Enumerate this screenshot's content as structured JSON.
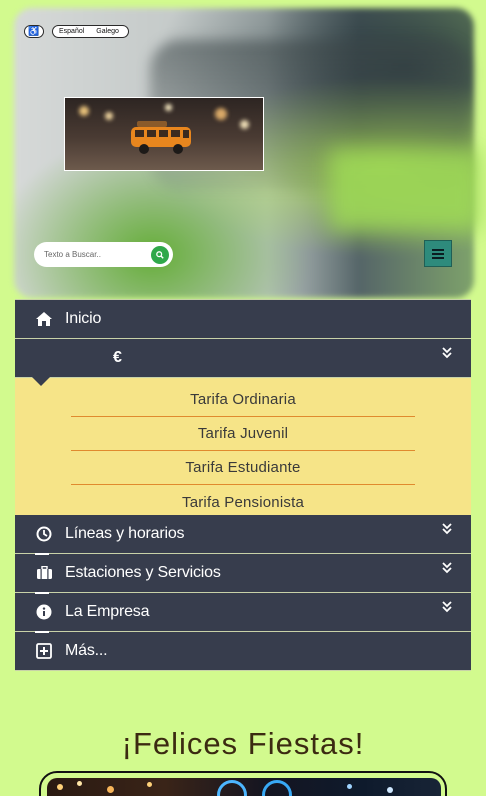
{
  "header": {
    "accessibility_icon": "wheelchair-icon",
    "languages": [
      "Español",
      "Galego"
    ]
  },
  "search": {
    "placeholder": "Texto a Buscar..",
    "button_icon": "search-icon"
  },
  "menu_button_icon": "hamburger-icon",
  "nav": {
    "items": [
      {
        "label": "Inicio",
        "icon": "home-icon"
      },
      {
        "label": "€",
        "icon": "euro-icon",
        "expanded": true
      },
      {
        "label": "Líneas y horarios",
        "icon": "clock-icon"
      },
      {
        "label": "Estaciones y Servicios",
        "icon": "briefcase-icon"
      },
      {
        "label": "La Empresa",
        "icon": "info-icon"
      },
      {
        "label": "Más...",
        "icon": "plus-square-icon"
      }
    ],
    "submenu": [
      "Tarifa Ordinaria",
      "Tarifa Juvenil",
      "Tarifa Estudiante",
      "Tarifa Pensionista"
    ]
  },
  "banner": {
    "title": "¡Felices Fiestas!"
  },
  "colors": {
    "page_bg": "#d2fa8e",
    "nav_bg": "#373d4d",
    "submenu_bg": "#f6e488",
    "submenu_divider": "#e08a2e",
    "search_button": "#2fa84a",
    "menu_button": "#2e8b7c"
  }
}
